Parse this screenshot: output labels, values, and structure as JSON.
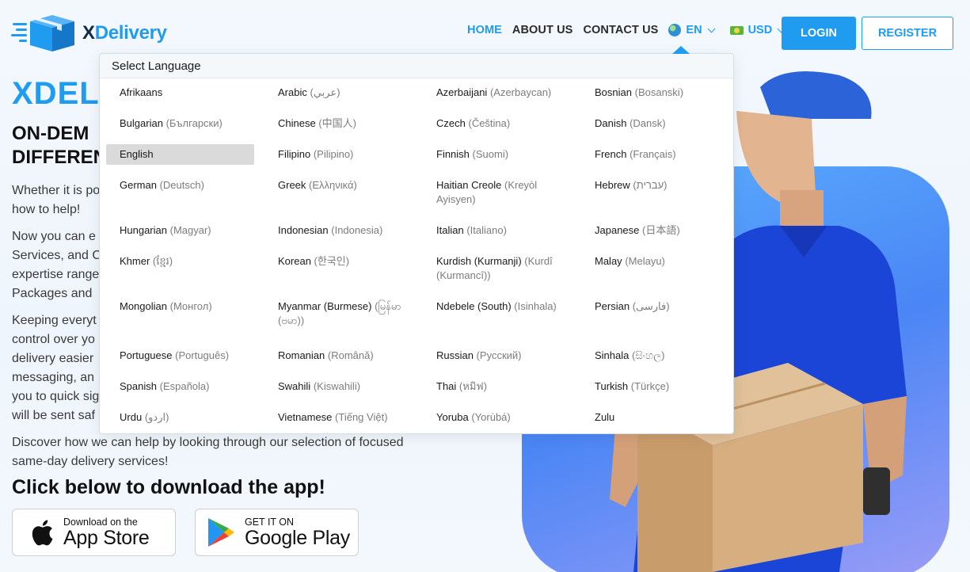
{
  "brand": {
    "name_prefix": "X",
    "name_rest": "Delivery",
    "color": "#1f9bf0"
  },
  "nav": {
    "items": [
      {
        "label": "HOME",
        "active": true
      },
      {
        "label": "ABOUT US",
        "active": false
      },
      {
        "label": "CONTACT US",
        "active": false
      }
    ],
    "language": {
      "value": "EN",
      "icon": "globe-icon"
    },
    "currency": {
      "value": "USD",
      "icon": "money-icon"
    },
    "login_label": "LOGIN",
    "register_label": "REGISTER"
  },
  "hero": {
    "title": "XDELI",
    "subtitle_line1": "ON-DEM",
    "subtitle_line2": "DIFFEREN",
    "paragraphs": [
      "Whether it is po\nhow to help!",
      "Now you can e\nServices, and C\nexpertise range\nPackages and",
      "Keeping everyt\ncontrol over yo\ndelivery easier\nmessaging, an\nyou to quick sig\nwill be sent saf",
      "Discover how we can help by looking through our selection of focused\nsame-day delivery services!"
    ],
    "download_title": "Click below to download the app!",
    "app_store": {
      "small": "Download on the",
      "big": "App Store",
      "icon": "apple-icon"
    },
    "google_play": {
      "small": "GET IT ON",
      "big": "Google Play",
      "icon": "google-play-icon"
    }
  },
  "language_dropdown": {
    "header": "Select Language",
    "selected": "English",
    "rows": [
      [
        {
          "name": "Afrikaans",
          "native": ""
        },
        {
          "name": "Arabic",
          "native": "(عربي)"
        },
        {
          "name": "Azerbaijani",
          "native": "(Azerbaycan)"
        },
        {
          "name": "Bosnian",
          "native": "(Bosanski)"
        }
      ],
      [
        {
          "name": "Bulgarian",
          "native": "(Български)"
        },
        {
          "name": "Chinese",
          "native": "(中国人)"
        },
        {
          "name": "Czech",
          "native": "(Čeština)"
        },
        {
          "name": "Danish",
          "native": "(Dansk)"
        }
      ],
      [
        {
          "name": "English",
          "native": ""
        },
        {
          "name": "Filipino",
          "native": "(Pilipino)"
        },
        {
          "name": "Finnish",
          "native": "(Suomi)"
        },
        {
          "name": "French",
          "native": "(Français)"
        }
      ],
      [
        {
          "name": "German",
          "native": "(Deutsch)"
        },
        {
          "name": "Greek",
          "native": "(Ελληνικά)"
        },
        {
          "name": "Haitian Creole",
          "native": "(Kreyòl Ayisyen)"
        },
        {
          "name": "Hebrew",
          "native": "(עברית)"
        }
      ],
      [
        {
          "name": "Hungarian",
          "native": "(Magyar)"
        },
        {
          "name": "Indonesian",
          "native": "(Indonesia)"
        },
        {
          "name": "Italian",
          "native": "(Italiano)"
        },
        {
          "name": "Japanese",
          "native": "(日本語)"
        }
      ],
      [
        {
          "name": "Khmer",
          "native": "(ខ្មែរ)"
        },
        {
          "name": "Korean",
          "native": "(한국인)"
        },
        {
          "name": "Kurdish (Kurmanji)",
          "native": "(Kurdî (Kurmancî))"
        },
        {
          "name": "Malay",
          "native": "(Melayu)"
        }
      ],
      [
        {
          "name": "Mongolian",
          "native": "(Монгол)"
        },
        {
          "name": "Myanmar (Burmese)",
          "native": "(မြန်မာ (ဗမာ))"
        },
        {
          "name": "Ndebele (South)",
          "native": "(Isinhala)"
        },
        {
          "name": "Persian",
          "native": "(فارسی)"
        }
      ],
      [
        {
          "name": "Portuguese",
          "native": "(Português)"
        },
        {
          "name": "Romanian",
          "native": "(Română)"
        },
        {
          "name": "Russian",
          "native": "(Русский)"
        },
        {
          "name": "Sinhala",
          "native": "(සිංහල)"
        }
      ],
      [
        {
          "name": "Spanish",
          "native": "(Española)"
        },
        {
          "name": "Swahili",
          "native": "(Kiswahili)"
        },
        {
          "name": "Thai",
          "native": "(หมิฟ)"
        },
        {
          "name": "Turkish",
          "native": "(Türkçe)"
        }
      ],
      [
        {
          "name": "Urdu",
          "native": "(اردو)"
        },
        {
          "name": "Vietnamese",
          "native": "(Tiếng Việt)"
        },
        {
          "name": "Yoruba",
          "native": "(Yorùbá)"
        },
        {
          "name": "Zulu",
          "native": ""
        }
      ]
    ]
  },
  "colors": {
    "accent": "#1f9bf0",
    "selected_bg": "#dadada"
  }
}
